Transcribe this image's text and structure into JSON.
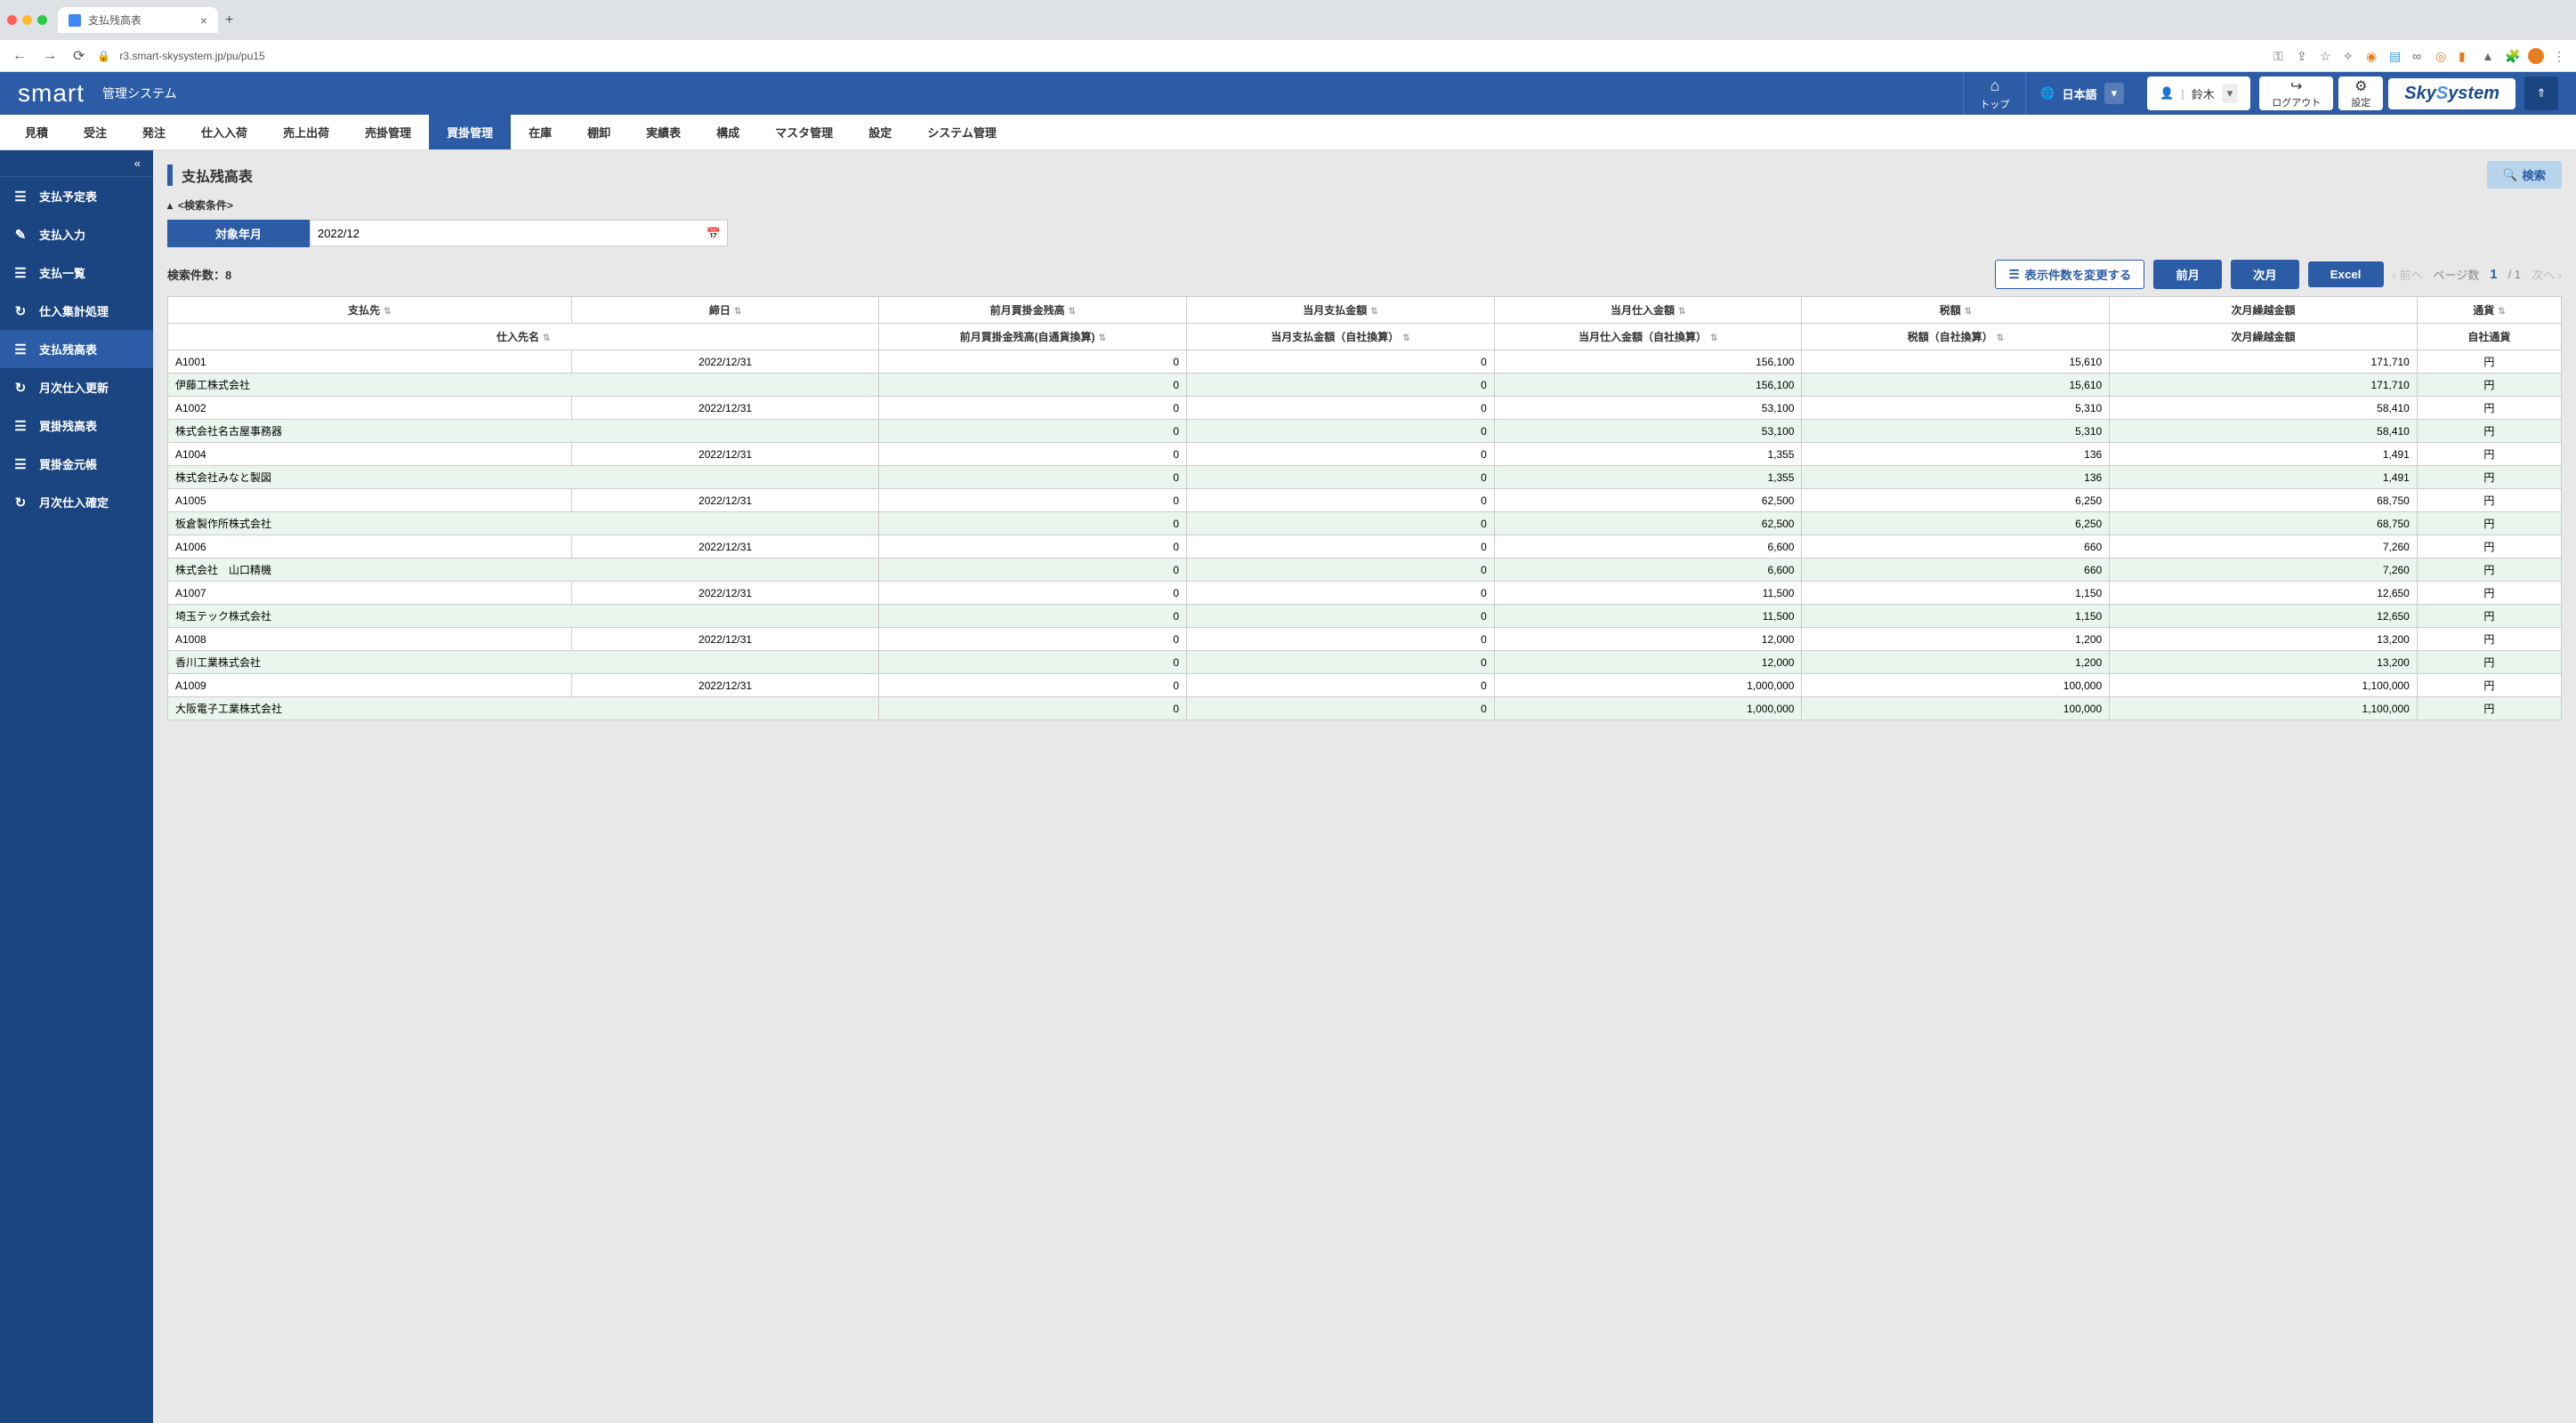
{
  "browser": {
    "tab_title": "支払残高表",
    "url": "r3.smart-skysystem.jp/pu/pu15"
  },
  "header": {
    "logo": "smart",
    "subtitle": "管理システム",
    "top": "トップ",
    "language": "日本語",
    "user": "鈴木",
    "logout": "ログアウト",
    "settings": "設定",
    "sky_logo_1": "Sky",
    "sky_logo_2": "S",
    "sky_logo_3": "ystem"
  },
  "topnav": [
    {
      "label": "見積",
      "active": false
    },
    {
      "label": "受注",
      "active": false
    },
    {
      "label": "発注",
      "active": false
    },
    {
      "label": "仕入入荷",
      "active": false
    },
    {
      "label": "売上出荷",
      "active": false
    },
    {
      "label": "売掛管理",
      "active": false
    },
    {
      "label": "買掛管理",
      "active": true
    },
    {
      "label": "在庫",
      "active": false
    },
    {
      "label": "棚卸",
      "active": false
    },
    {
      "label": "実績表",
      "active": false
    },
    {
      "label": "構成",
      "active": false
    },
    {
      "label": "マスタ管理",
      "active": false
    },
    {
      "label": "設定",
      "active": false
    },
    {
      "label": "システム管理",
      "active": false
    }
  ],
  "sidebar": [
    {
      "icon": "list",
      "label": "支払予定表",
      "active": false
    },
    {
      "icon": "edit",
      "label": "支払入力",
      "active": false
    },
    {
      "icon": "list",
      "label": "支払一覧",
      "active": false
    },
    {
      "icon": "refresh",
      "label": "仕入集計処理",
      "active": false
    },
    {
      "icon": "list",
      "label": "支払残高表",
      "active": true
    },
    {
      "icon": "refresh",
      "label": "月次仕入更新",
      "active": false
    },
    {
      "icon": "list",
      "label": "買掛残高表",
      "active": false
    },
    {
      "icon": "list",
      "label": "買掛金元帳",
      "active": false
    },
    {
      "icon": "refresh",
      "label": "月次仕入確定",
      "active": false
    }
  ],
  "page": {
    "title": "支払残高表",
    "search_btn": "検索",
    "search_cond_label": "<検索条件>",
    "target_month_label": "対象年月",
    "target_month_value": "2022/12",
    "results_label": "検索件数：8",
    "change_display": "表示件数を変更する",
    "prev_month": "前月",
    "next_month": "次月",
    "excel": "Excel",
    "pager_prev": "前へ",
    "pager_next": "次へ",
    "pager_label": "ページ数",
    "pager_current": "1",
    "pager_total": "/ 1"
  },
  "table": {
    "headers_row1": {
      "payee": "支払先",
      "closing": "締日",
      "prev_balance": "前月買掛金残高",
      "cur_payment": "当月支払金額",
      "cur_purchase": "当月仕入金額",
      "tax": "税額",
      "carryover": "次月繰越金額",
      "currency": "通貨"
    },
    "headers_row2": {
      "supplier": "仕入先名",
      "prev_balance_conv": "前月買掛金残高(自通貨換算)",
      "cur_payment_conv": "当月支払金額（自社換算）",
      "cur_purchase_conv": "当月仕入金額（自社換算）",
      "tax_conv": "税額（自社換算）",
      "carryover2": "次月繰越金額",
      "own_currency": "自社通貨"
    },
    "rows": [
      {
        "a": {
          "code": "A1001",
          "date": "2022/12/31",
          "prev": "0",
          "pay": "0",
          "purch": "156,100",
          "tax": "15,610",
          "carry": "171,710",
          "curr": "円"
        },
        "b": {
          "name": "伊藤工株式会社",
          "prev": "0",
          "pay": "0",
          "purch": "156,100",
          "tax": "15,610",
          "carry": "171,710",
          "curr": "円"
        }
      },
      {
        "a": {
          "code": "A1002",
          "date": "2022/12/31",
          "prev": "0",
          "pay": "0",
          "purch": "53,100",
          "tax": "5,310",
          "carry": "58,410",
          "curr": "円"
        },
        "b": {
          "name": "株式会社名古屋事務器",
          "prev": "0",
          "pay": "0",
          "purch": "53,100",
          "tax": "5,310",
          "carry": "58,410",
          "curr": "円"
        }
      },
      {
        "a": {
          "code": "A1004",
          "date": "2022/12/31",
          "prev": "0",
          "pay": "0",
          "purch": "1,355",
          "tax": "136",
          "carry": "1,491",
          "curr": "円"
        },
        "b": {
          "name": "株式会社みなと製図",
          "prev": "0",
          "pay": "0",
          "purch": "1,355",
          "tax": "136",
          "carry": "1,491",
          "curr": "円"
        }
      },
      {
        "a": {
          "code": "A1005",
          "date": "2022/12/31",
          "prev": "0",
          "pay": "0",
          "purch": "62,500",
          "tax": "6,250",
          "carry": "68,750",
          "curr": "円"
        },
        "b": {
          "name": "板倉製作所株式会社",
          "prev": "0",
          "pay": "0",
          "purch": "62,500",
          "tax": "6,250",
          "carry": "68,750",
          "curr": "円"
        }
      },
      {
        "a": {
          "code": "A1006",
          "date": "2022/12/31",
          "prev": "0",
          "pay": "0",
          "purch": "6,600",
          "tax": "660",
          "carry": "7,260",
          "curr": "円"
        },
        "b": {
          "name": "株式会社　山口精機",
          "prev": "0",
          "pay": "0",
          "purch": "6,600",
          "tax": "660",
          "carry": "7,260",
          "curr": "円"
        }
      },
      {
        "a": {
          "code": "A1007",
          "date": "2022/12/31",
          "prev": "0",
          "pay": "0",
          "purch": "11,500",
          "tax": "1,150",
          "carry": "12,650",
          "curr": "円"
        },
        "b": {
          "name": "埼玉テック株式会社",
          "prev": "0",
          "pay": "0",
          "purch": "11,500",
          "tax": "1,150",
          "carry": "12,650",
          "curr": "円"
        }
      },
      {
        "a": {
          "code": "A1008",
          "date": "2022/12/31",
          "prev": "0",
          "pay": "0",
          "purch": "12,000",
          "tax": "1,200",
          "carry": "13,200",
          "curr": "円"
        },
        "b": {
          "name": "香川工業株式会社",
          "prev": "0",
          "pay": "0",
          "purch": "12,000",
          "tax": "1,200",
          "carry": "13,200",
          "curr": "円"
        }
      },
      {
        "a": {
          "code": "A1009",
          "date": "2022/12/31",
          "prev": "0",
          "pay": "0",
          "purch": "1,000,000",
          "tax": "100,000",
          "carry": "1,100,000",
          "curr": "円"
        },
        "b": {
          "name": "大阪電子工業株式会社",
          "prev": "0",
          "pay": "0",
          "purch": "1,000,000",
          "tax": "100,000",
          "carry": "1,100,000",
          "curr": "円"
        }
      }
    ]
  }
}
